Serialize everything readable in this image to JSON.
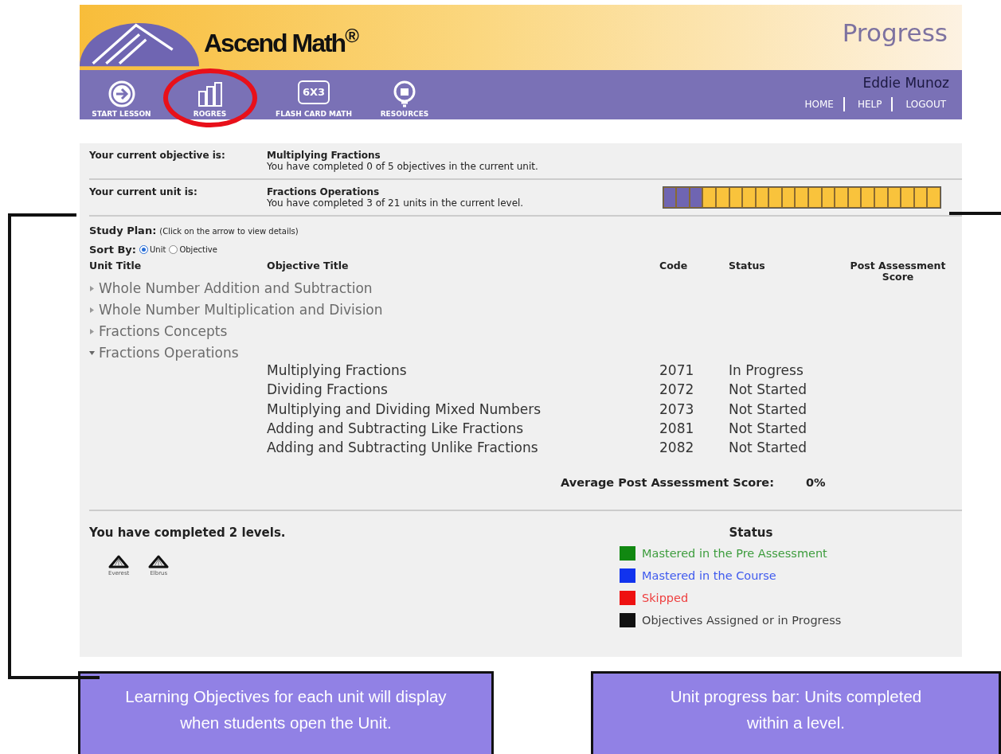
{
  "header": {
    "logo": "Ascend Math$^{®}$",
    "page_title": "Progress",
    "user_name": "Eddie Munoz",
    "nav": [
      {
        "kind": "arrow",
        "label": "START LESSON"
      },
      {
        "kind": "bars",
        "label": "ROGRES"
      },
      {
        "kind": "flash",
        "icon_text": "6X3",
        "label": "FLASH CARD MATH"
      },
      {
        "kind": "bulb",
        "label": "RESOURCES"
      }
    ],
    "links": [
      "HOME",
      "HELP",
      "LOGOUT"
    ]
  },
  "objective": {
    "label": "Your current objective is:",
    "value": "Multiplying Fractions",
    "note": "You have completed 0 of 5 objectives in the current unit."
  },
  "unit": {
    "label": "Your current unit is:",
    "value": "Fractions Operations",
    "note": "You have completed 3 of 21 units in the current level.",
    "segments": [
      {
        "completed": true
      },
      {
        "completed": true
      },
      {
        "completed": true
      },
      {
        "completed": false
      },
      {
        "completed": false
      },
      {
        "completed": false
      },
      {
        "completed": false
      },
      {
        "completed": false
      },
      {
        "completed": false
      },
      {
        "completed": false
      },
      {
        "completed": false
      },
      {
        "completed": false
      },
      {
        "completed": false
      },
      {
        "completed": false
      },
      {
        "completed": false
      },
      {
        "completed": false
      },
      {
        "completed": false
      },
      {
        "completed": false
      },
      {
        "completed": false
      },
      {
        "completed": false
      },
      {
        "completed": false
      }
    ]
  },
  "study_plan": {
    "label": "Study Plan:",
    "hint": "(Click on the arrow to view details)",
    "sort_label": "Sort By:",
    "sort_options": [
      {
        "label": "Unit",
        "selected": true
      },
      {
        "label": "Objective",
        "selected": false
      }
    ],
    "columns": [
      "Unit Title",
      "Objective Title",
      "Code",
      "Status",
      "Post Assessment Score"
    ],
    "units": [
      {
        "title": "Whole Number Addition and Subtraction",
        "expanded": false
      },
      {
        "title": "Whole Number Multiplication and Division",
        "expanded": false
      },
      {
        "title": "Fractions Concepts",
        "expanded": false
      },
      {
        "title": "Fractions Operations",
        "expanded": true,
        "children": [
          {
            "title": "Multiplying Fractions",
            "code": "2071",
            "status": "In Progress"
          },
          {
            "title": "Dividing Fractions",
            "code": "2072",
            "status": "Not Started"
          },
          {
            "title": "Multiplying and Dividing Mixed Numbers",
            "code": "2073",
            "status": "Not Started"
          },
          {
            "title": "Adding and Subtracting Like Fractions",
            "code": "2081",
            "status": "Not Started"
          },
          {
            "title": "Adding and Subtracting Unlike Fractions",
            "code": "2082",
            "status": "Not Started"
          }
        ]
      }
    ],
    "average_label": "Average Post Assessment Score:",
    "average_value": "0%"
  },
  "levels": {
    "title": "You have completed 2 levels.",
    "items": [
      "Everest",
      "Elbrus"
    ]
  },
  "legend": {
    "title": "Status",
    "items": [
      {
        "label": "Mastered in the Pre Assessment",
        "color": "#118811"
      },
      {
        "label": "Mastered in the Course",
        "color": "#1133ee"
      },
      {
        "label": "Skipped",
        "color": "#ee1111"
      },
      {
        "label": "Objectives Assigned or in Progress",
        "color": "#111111"
      }
    ]
  },
  "callouts": [
    "Learning Objectives for each unit will display when students open the Unit.",
    "Unit progress bar: Units completed within a level."
  ]
}
